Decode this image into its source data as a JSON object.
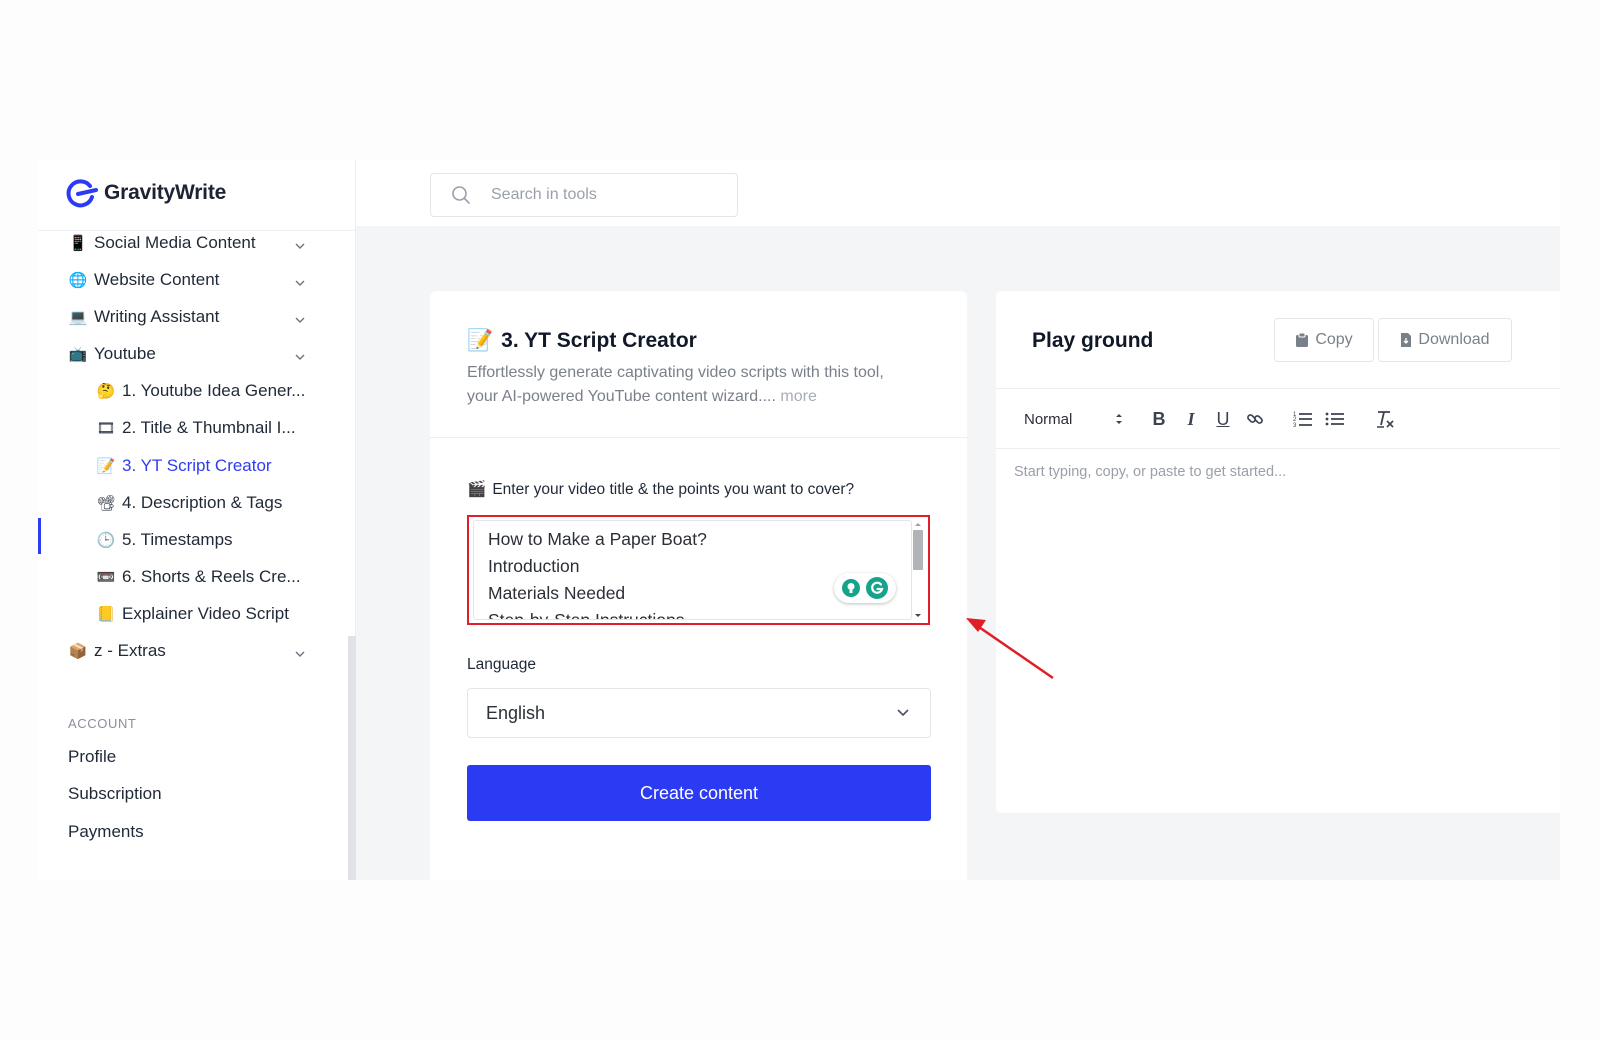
{
  "brand": {
    "name": "GravityWrite",
    "accent": "#2b3af3",
    "highlight": "#e01e27"
  },
  "search": {
    "placeholder": "Search in tools"
  },
  "sidebar": {
    "items": [
      {
        "icon": "mobile-phone-icon",
        "glyph": "📱",
        "label": "Social Media Content",
        "expandable": true
      },
      {
        "icon": "globe-icon",
        "glyph": "🌐",
        "label": "Website Content",
        "expandable": true
      },
      {
        "icon": "laptop-icon",
        "glyph": "💻",
        "label": "Writing Assistant",
        "expandable": true
      },
      {
        "icon": "tv-icon",
        "glyph": "📺",
        "label": "Youtube",
        "expandable": true
      },
      {
        "icon": "thinking-face-icon",
        "glyph": "🤔",
        "label": "1. Youtube Idea Gener...",
        "sub": true
      },
      {
        "icon": "film-strip-icon",
        "glyph": "🎞",
        "label": "2. Title & Thumbnail I...",
        "sub": true
      },
      {
        "icon": "memo-icon",
        "glyph": "📝",
        "label": "3. YT Script Creator",
        "sub": true,
        "active": true
      },
      {
        "icon": "projector-icon",
        "glyph": "📽",
        "label": "4. Description & Tags",
        "sub": true
      },
      {
        "icon": "clock-icon",
        "glyph": "🕒",
        "label": "5. Timestamps",
        "sub": true
      },
      {
        "icon": "videocassette-icon",
        "glyph": "📼",
        "label": "6. Shorts & Reels Cre...",
        "sub": true
      },
      {
        "icon": "notebook-icon",
        "glyph": "📒",
        "label": "Explainer Video Script",
        "sub": true
      },
      {
        "icon": "package-icon",
        "glyph": "📦",
        "label": "z - Extras",
        "expandable": true
      }
    ],
    "account_heading": "ACCOUNT",
    "account_links": [
      "Profile",
      "Subscription",
      "Payments"
    ]
  },
  "tool": {
    "icon": "memo-icon",
    "title": "3. YT Script Creator",
    "description": "Effortlessly generate captivating video scripts with this tool, your AI-powered YouTube content wizard....",
    "more": "more",
    "prompt_label": "Enter your video title & the points you want to cover?",
    "prompt_lines": [
      "How to Make a Paper Boat?",
      "Introduction",
      "Materials Needed",
      "Step-by-Step Instructions"
    ],
    "language_label": "Language",
    "language_value": "English",
    "create_button": "Create content"
  },
  "playground": {
    "title": "Play ground",
    "copy_button": "Copy",
    "download_button": "Download",
    "format_select": "Normal",
    "editor_placeholder": "Start typing, copy, or paste to get started..."
  }
}
